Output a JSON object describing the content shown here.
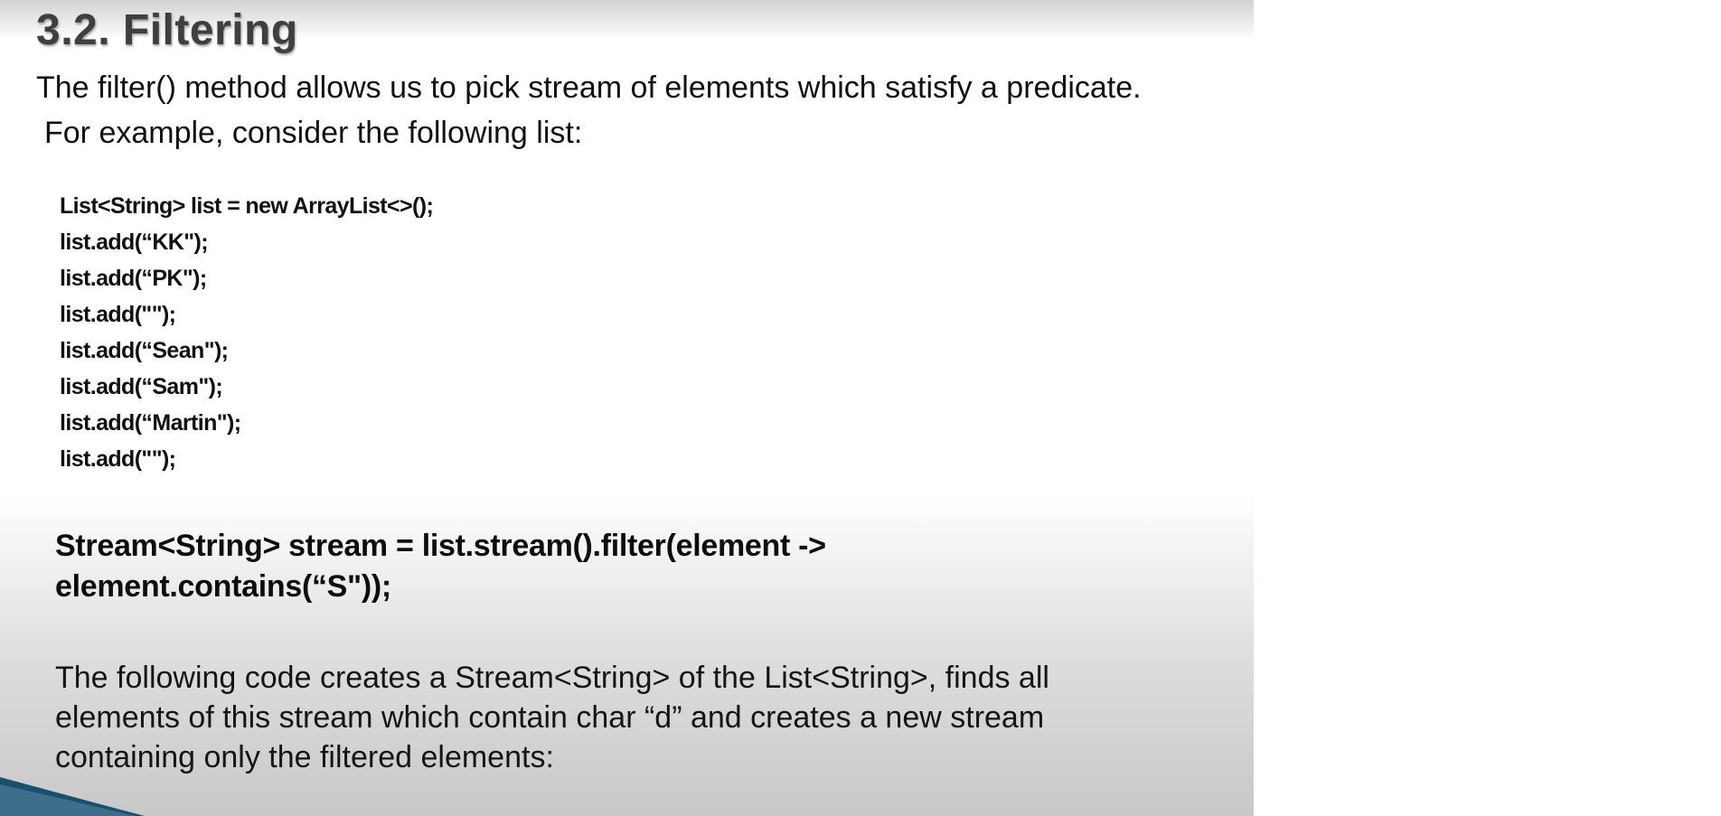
{
  "slide": {
    "title": "3.2. Filtering",
    "intro": [
      "The filter() method allows us to pick stream of elements which satisfy a predicate.",
      "For example, consider the following list:"
    ],
    "code_lines": [
      "List<String> list = new ArrayList<>();",
      "list.add(“KK\");",
      "list.add(“PK\");",
      "list.add(\"\");",
      "list.add(“Sean\");",
      "list.add(“Sam\");",
      "list.add(“Martin\");",
      "list.add(\"\");"
    ],
    "stream_code": [
      "Stream<String> stream = list.stream().filter(element ->",
      "element.contains(“S\"));"
    ],
    "explanation": [
      "The following code creates a Stream<String> of the List<String>, finds all",
      "elements of this stream which contain char “d” and creates a new stream",
      "containing only the filtered elements:"
    ]
  },
  "colors": {
    "title": "#3f3f3f",
    "text": "#111111",
    "accent_swoosh": "#1a4f6e"
  }
}
